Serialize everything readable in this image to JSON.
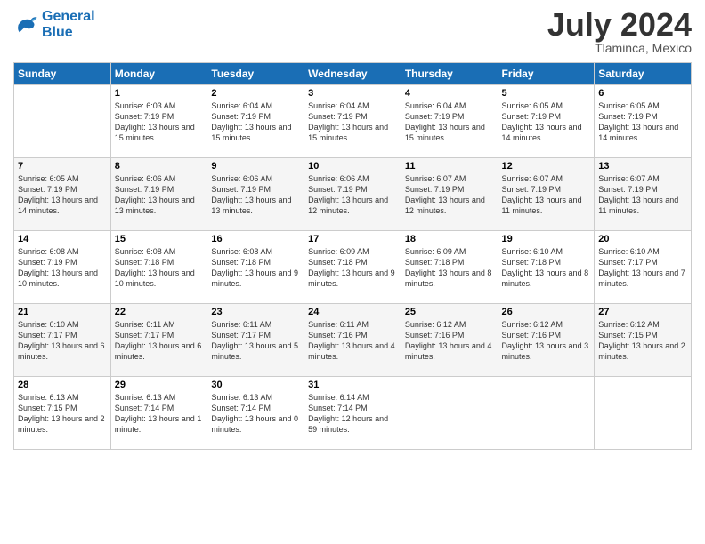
{
  "logo": {
    "line1": "General",
    "line2": "Blue"
  },
  "title": "July 2024",
  "location": "Tlaminca, Mexico",
  "days_of_week": [
    "Sunday",
    "Monday",
    "Tuesday",
    "Wednesday",
    "Thursday",
    "Friday",
    "Saturday"
  ],
  "weeks": [
    [
      {
        "day": "",
        "sunrise": "",
        "sunset": "",
        "daylight": ""
      },
      {
        "day": "1",
        "sunrise": "Sunrise: 6:03 AM",
        "sunset": "Sunset: 7:19 PM",
        "daylight": "Daylight: 13 hours and 15 minutes."
      },
      {
        "day": "2",
        "sunrise": "Sunrise: 6:04 AM",
        "sunset": "Sunset: 7:19 PM",
        "daylight": "Daylight: 13 hours and 15 minutes."
      },
      {
        "day": "3",
        "sunrise": "Sunrise: 6:04 AM",
        "sunset": "Sunset: 7:19 PM",
        "daylight": "Daylight: 13 hours and 15 minutes."
      },
      {
        "day": "4",
        "sunrise": "Sunrise: 6:04 AM",
        "sunset": "Sunset: 7:19 PM",
        "daylight": "Daylight: 13 hours and 15 minutes."
      },
      {
        "day": "5",
        "sunrise": "Sunrise: 6:05 AM",
        "sunset": "Sunset: 7:19 PM",
        "daylight": "Daylight: 13 hours and 14 minutes."
      },
      {
        "day": "6",
        "sunrise": "Sunrise: 6:05 AM",
        "sunset": "Sunset: 7:19 PM",
        "daylight": "Daylight: 13 hours and 14 minutes."
      }
    ],
    [
      {
        "day": "7",
        "sunrise": "Sunrise: 6:05 AM",
        "sunset": "Sunset: 7:19 PM",
        "daylight": "Daylight: 13 hours and 14 minutes."
      },
      {
        "day": "8",
        "sunrise": "Sunrise: 6:06 AM",
        "sunset": "Sunset: 7:19 PM",
        "daylight": "Daylight: 13 hours and 13 minutes."
      },
      {
        "day": "9",
        "sunrise": "Sunrise: 6:06 AM",
        "sunset": "Sunset: 7:19 PM",
        "daylight": "Daylight: 13 hours and 13 minutes."
      },
      {
        "day": "10",
        "sunrise": "Sunrise: 6:06 AM",
        "sunset": "Sunset: 7:19 PM",
        "daylight": "Daylight: 13 hours and 12 minutes."
      },
      {
        "day": "11",
        "sunrise": "Sunrise: 6:07 AM",
        "sunset": "Sunset: 7:19 PM",
        "daylight": "Daylight: 13 hours and 12 minutes."
      },
      {
        "day": "12",
        "sunrise": "Sunrise: 6:07 AM",
        "sunset": "Sunset: 7:19 PM",
        "daylight": "Daylight: 13 hours and 11 minutes."
      },
      {
        "day": "13",
        "sunrise": "Sunrise: 6:07 AM",
        "sunset": "Sunset: 7:19 PM",
        "daylight": "Daylight: 13 hours and 11 minutes."
      }
    ],
    [
      {
        "day": "14",
        "sunrise": "Sunrise: 6:08 AM",
        "sunset": "Sunset: 7:19 PM",
        "daylight": "Daylight: 13 hours and 10 minutes."
      },
      {
        "day": "15",
        "sunrise": "Sunrise: 6:08 AM",
        "sunset": "Sunset: 7:18 PM",
        "daylight": "Daylight: 13 hours and 10 minutes."
      },
      {
        "day": "16",
        "sunrise": "Sunrise: 6:08 AM",
        "sunset": "Sunset: 7:18 PM",
        "daylight": "Daylight: 13 hours and 9 minutes."
      },
      {
        "day": "17",
        "sunrise": "Sunrise: 6:09 AM",
        "sunset": "Sunset: 7:18 PM",
        "daylight": "Daylight: 13 hours and 9 minutes."
      },
      {
        "day": "18",
        "sunrise": "Sunrise: 6:09 AM",
        "sunset": "Sunset: 7:18 PM",
        "daylight": "Daylight: 13 hours and 8 minutes."
      },
      {
        "day": "19",
        "sunrise": "Sunrise: 6:10 AM",
        "sunset": "Sunset: 7:18 PM",
        "daylight": "Daylight: 13 hours and 8 minutes."
      },
      {
        "day": "20",
        "sunrise": "Sunrise: 6:10 AM",
        "sunset": "Sunset: 7:17 PM",
        "daylight": "Daylight: 13 hours and 7 minutes."
      }
    ],
    [
      {
        "day": "21",
        "sunrise": "Sunrise: 6:10 AM",
        "sunset": "Sunset: 7:17 PM",
        "daylight": "Daylight: 13 hours and 6 minutes."
      },
      {
        "day": "22",
        "sunrise": "Sunrise: 6:11 AM",
        "sunset": "Sunset: 7:17 PM",
        "daylight": "Daylight: 13 hours and 6 minutes."
      },
      {
        "day": "23",
        "sunrise": "Sunrise: 6:11 AM",
        "sunset": "Sunset: 7:17 PM",
        "daylight": "Daylight: 13 hours and 5 minutes."
      },
      {
        "day": "24",
        "sunrise": "Sunrise: 6:11 AM",
        "sunset": "Sunset: 7:16 PM",
        "daylight": "Daylight: 13 hours and 4 minutes."
      },
      {
        "day": "25",
        "sunrise": "Sunrise: 6:12 AM",
        "sunset": "Sunset: 7:16 PM",
        "daylight": "Daylight: 13 hours and 4 minutes."
      },
      {
        "day": "26",
        "sunrise": "Sunrise: 6:12 AM",
        "sunset": "Sunset: 7:16 PM",
        "daylight": "Daylight: 13 hours and 3 minutes."
      },
      {
        "day": "27",
        "sunrise": "Sunrise: 6:12 AM",
        "sunset": "Sunset: 7:15 PM",
        "daylight": "Daylight: 13 hours and 2 minutes."
      }
    ],
    [
      {
        "day": "28",
        "sunrise": "Sunrise: 6:13 AM",
        "sunset": "Sunset: 7:15 PM",
        "daylight": "Daylight: 13 hours and 2 minutes."
      },
      {
        "day": "29",
        "sunrise": "Sunrise: 6:13 AM",
        "sunset": "Sunset: 7:14 PM",
        "daylight": "Daylight: 13 hours and 1 minute."
      },
      {
        "day": "30",
        "sunrise": "Sunrise: 6:13 AM",
        "sunset": "Sunset: 7:14 PM",
        "daylight": "Daylight: 13 hours and 0 minutes."
      },
      {
        "day": "31",
        "sunrise": "Sunrise: 6:14 AM",
        "sunset": "Sunset: 7:14 PM",
        "daylight": "Daylight: 12 hours and 59 minutes."
      },
      {
        "day": "",
        "sunrise": "",
        "sunset": "",
        "daylight": ""
      },
      {
        "day": "",
        "sunrise": "",
        "sunset": "",
        "daylight": ""
      },
      {
        "day": "",
        "sunrise": "",
        "sunset": "",
        "daylight": ""
      }
    ]
  ]
}
